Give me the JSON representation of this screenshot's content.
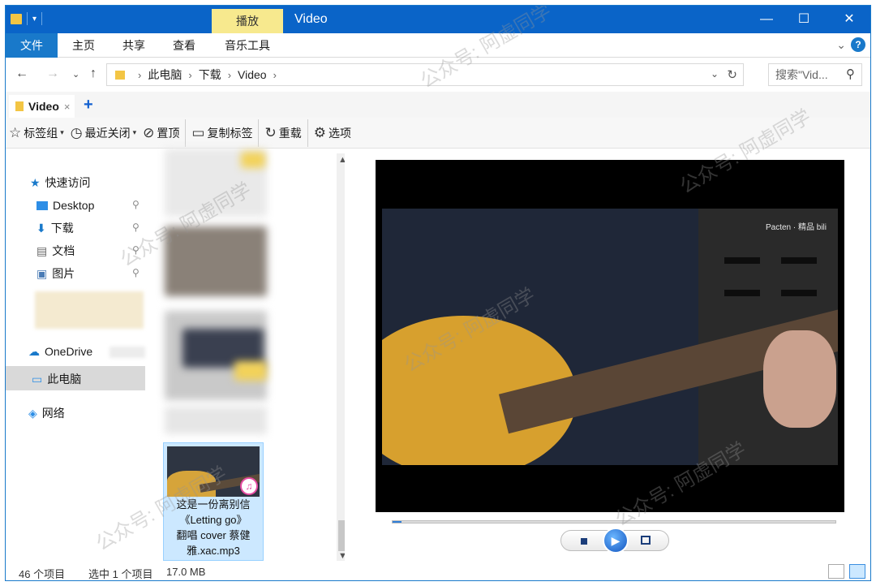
{
  "titlebar": {
    "context_tab": "播放",
    "window_title": "Video",
    "minimize": "—",
    "maximize": "☐",
    "close": "✕"
  },
  "ribbon": {
    "tabs": [
      "文件",
      "主页",
      "共享",
      "查看",
      "音乐工具"
    ]
  },
  "address": {
    "crumbs": [
      "此电脑",
      "下载",
      "Video"
    ],
    "search_placeholder": "搜索\"Vid..."
  },
  "tabs": {
    "active_label": "Video",
    "close": "×",
    "add": "+"
  },
  "toolbar": {
    "items": [
      "标签组",
      "最近关闭",
      "置顶",
      "复制标签",
      "重载",
      "选项"
    ]
  },
  "navpane": {
    "quick_access": "快速访问",
    "pinned": [
      "Desktop",
      "下载",
      "文档",
      "图片"
    ],
    "onedrive": "OneDrive",
    "this_pc": "此电脑",
    "network": "网络"
  },
  "files": {
    "selected_name_lines": [
      "这是一份离别信",
      "《Letting go》",
      "翻唱 cover 蔡健",
      "雅.xac.mp3"
    ]
  },
  "preview": {
    "video_watermark": "Pacten · 精品 bili",
    "progress": 0.02
  },
  "status": {
    "item_count": "46 个项目",
    "selection": "选中 1 个项目",
    "size": "17.0 MB"
  },
  "overlay_watermark": "公众号: 阿虚同学",
  "colors": {
    "titlebar": "#0a64c8",
    "context_tab": "#f7e98e",
    "selection": "#cce8ff",
    "accent": "#1979ca"
  }
}
